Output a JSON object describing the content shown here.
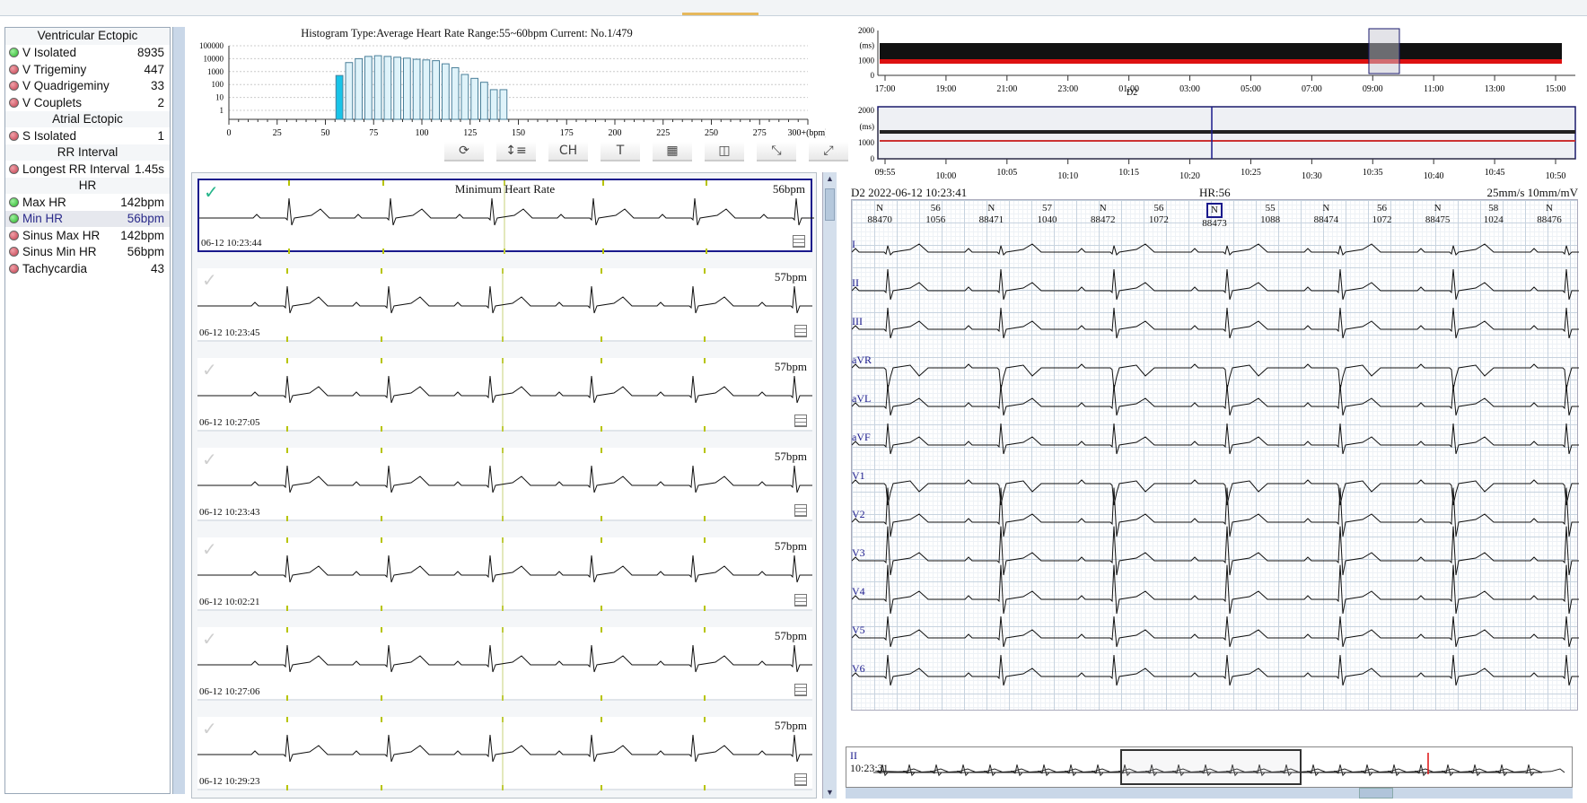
{
  "stats": {
    "sections": [
      {
        "title": "Ventricular Ectopic",
        "rows": [
          {
            "label": "V Isolated",
            "value": "8935",
            "status": "green"
          },
          {
            "label": "V Trigeminy",
            "value": "447",
            "status": "red"
          },
          {
            "label": "V Quadrigeminy",
            "value": "33",
            "status": "red"
          },
          {
            "label": "V Couplets",
            "value": "2",
            "status": "red"
          }
        ]
      },
      {
        "title": "Atrial Ectopic",
        "rows": [
          {
            "label": "S Isolated",
            "value": "1",
            "status": "red"
          }
        ]
      },
      {
        "title": "RR Interval",
        "rows": [
          {
            "label": "Longest RR Interval",
            "value": "1.45s",
            "status": "red"
          }
        ]
      },
      {
        "title": "HR",
        "rows": [
          {
            "label": "Max HR",
            "value": "142bpm",
            "status": "green"
          },
          {
            "label": "Min HR",
            "value": "56bpm",
            "status": "green",
            "selected": true
          },
          {
            "label": "Sinus Max HR",
            "value": "142bpm",
            "status": "red"
          },
          {
            "label": "Sinus Min HR",
            "value": "56bpm",
            "status": "red"
          },
          {
            "label": "Tachycardia",
            "value": "43",
            "status": "red"
          }
        ]
      }
    ]
  },
  "histogram": {
    "title": "Histogram Type:Average Heart Rate   Range:55~60bpm  Current: No.1/479",
    "y_ticks": [
      "100000",
      "10000",
      "1000",
      "100",
      "10",
      "1"
    ],
    "x_ticks": [
      "0",
      "25",
      "50",
      "75",
      "100",
      "125",
      "150",
      "175",
      "200",
      "225",
      "250",
      "275",
      "300+(bpm)"
    ],
    "bin_start": 55,
    "bin_width": 5,
    "counts": [
      500,
      5000,
      10000,
      15000,
      17000,
      15000,
      13000,
      11000,
      9000,
      8000,
      7000,
      4000,
      2000,
      600,
      300,
      150,
      40,
      40
    ],
    "selected_bin": 0,
    "selected_color": "#19c4e8",
    "bar_color": "#dff3fa"
  },
  "toolbar": [
    {
      "name": "refresh",
      "glyph": "⟳"
    },
    {
      "name": "sort",
      "glyph": "↕≡"
    },
    {
      "name": "channel",
      "glyph": "CH"
    },
    {
      "name": "text",
      "glyph": "T"
    },
    {
      "name": "grid-4",
      "glyph": "▦"
    },
    {
      "name": "grid-select",
      "glyph": "◫"
    },
    {
      "name": "collapse",
      "glyph": "⤡"
    },
    {
      "name": "expand",
      "glyph": "⤢"
    }
  ],
  "strips": [
    {
      "title": "Minimum Heart Rate",
      "bpm": "56bpm",
      "time": "06-12 10:23:44",
      "selected": true
    },
    {
      "title": "",
      "bpm": "57bpm",
      "time": "06-12 10:23:45"
    },
    {
      "title": "",
      "bpm": "57bpm",
      "time": "06-12 10:27:05"
    },
    {
      "title": "",
      "bpm": "57bpm",
      "time": "06-12 10:23:43"
    },
    {
      "title": "",
      "bpm": "57bpm",
      "time": "06-12 10:02:21"
    },
    {
      "title": "",
      "bpm": "57bpm",
      "time": "06-12 10:27:06"
    },
    {
      "title": "",
      "bpm": "57bpm",
      "time": "06-12 10:29:23"
    }
  ],
  "trend_full": {
    "y_ticks": [
      "2000",
      "(ms)",
      "1000",
      "0"
    ],
    "x_ticks": [
      "17:00",
      "19:00",
      "21:00",
      "23:00",
      "01:00",
      "03:00",
      "05:00",
      "07:00",
      "09:00",
      "11:00",
      "13:00",
      "15:00"
    ],
    "channel": "D2"
  },
  "trend_zoom": {
    "y_ticks": [
      "2000",
      "(ms)",
      "1000",
      "0"
    ],
    "x_ticks": [
      "09:55",
      "10:00",
      "10:05",
      "10:10",
      "10:15",
      "10:20",
      "10:25",
      "10:30",
      "10:35",
      "10:40",
      "10:45",
      "10:50"
    ]
  },
  "ecg": {
    "header_left": "D2 2022-06-12 10:23:41",
    "header_hr": "HR:56",
    "header_right": "25mm/s 10mm/mV",
    "beats": [
      {
        "top": "N",
        "bottom": "88470"
      },
      {
        "top": "56",
        "bottom": "1056"
      },
      {
        "top": "N",
        "bottom": "88471"
      },
      {
        "top": "57",
        "bottom": "1040"
      },
      {
        "top": "N",
        "bottom": "88472"
      },
      {
        "top": "56",
        "bottom": "1072"
      },
      {
        "top": "N",
        "bottom": "88473",
        "current": true
      },
      {
        "top": "55",
        "bottom": "1088"
      },
      {
        "top": "N",
        "bottom": "88474"
      },
      {
        "top": "56",
        "bottom": "1072"
      },
      {
        "top": "N",
        "bottom": "88475"
      },
      {
        "top": "58",
        "bottom": "1024"
      },
      {
        "top": "N",
        "bottom": "88476"
      }
    ],
    "leads": [
      "I",
      "II",
      "III",
      "aVR",
      "aVL",
      "aVF",
      "V1",
      "V2",
      "V3",
      "V4",
      "V5",
      "V6"
    ]
  },
  "overview_strip": {
    "lead": "II",
    "time": "10:23:31"
  }
}
